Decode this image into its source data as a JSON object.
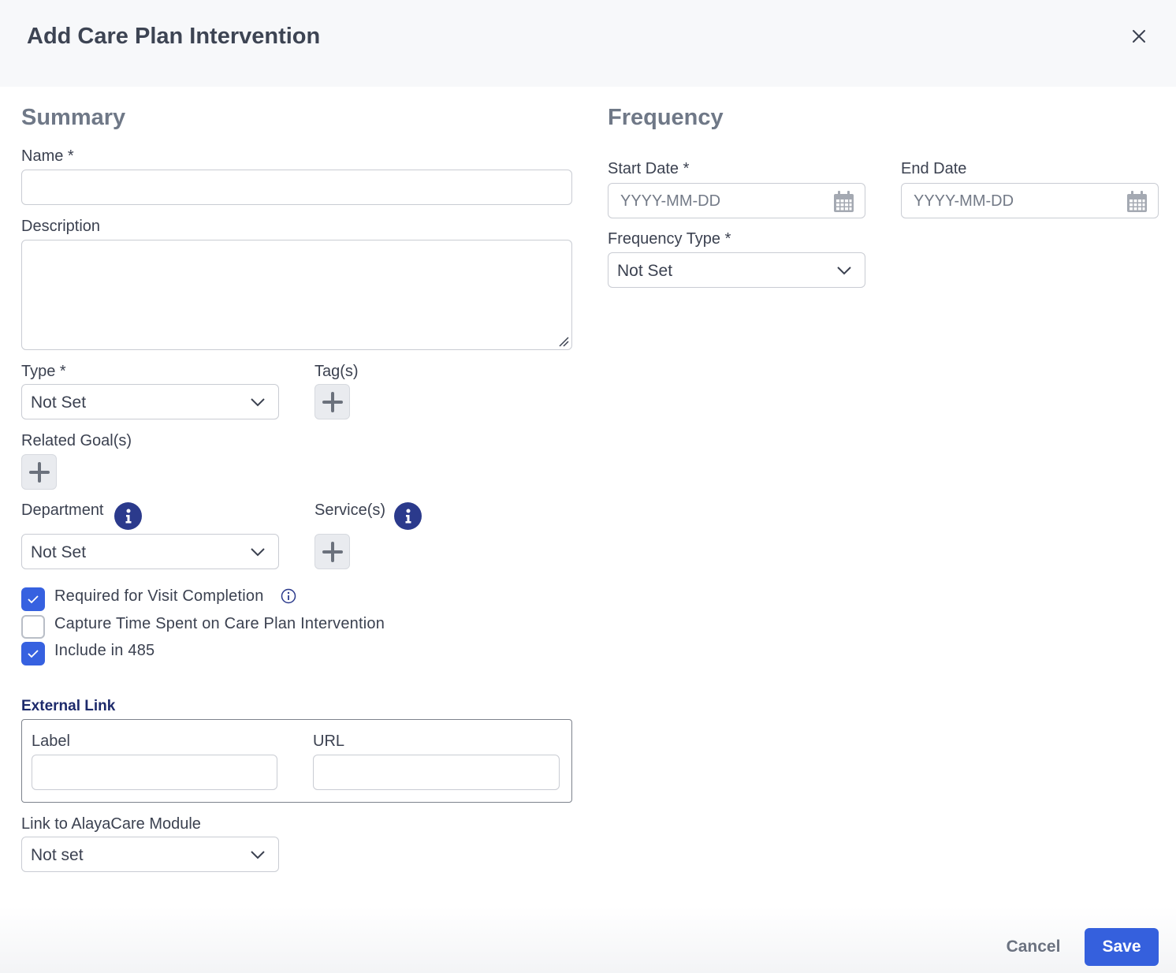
{
  "dialog": {
    "title": "Add Care Plan Intervention"
  },
  "summary": {
    "heading": "Summary",
    "name_label": "Name *",
    "name_value": "",
    "description_label": "Description",
    "description_value": "",
    "type_label": "Type *",
    "type_value": "Not Set",
    "tags_label": "Tag(s)",
    "related_goals_label": "Related Goal(s)",
    "department_label": "Department",
    "department_value": "Not Set",
    "services_label": "Service(s)",
    "checkboxes": [
      {
        "label": "Required for Visit Completion",
        "checked": true
      },
      {
        "label": "Capture Time Spent on Care Plan Intervention",
        "checked": false
      },
      {
        "label": "Include in 485",
        "checked": true
      }
    ],
    "external_link": {
      "heading": "External Link",
      "label_label": "Label",
      "label_value": "",
      "url_label": "URL",
      "url_value": ""
    },
    "module_label": "Link to AlayaCare Module",
    "module_value": "Not set"
  },
  "frequency": {
    "heading": "Frequency",
    "start_date_label": "Start Date *",
    "start_date_placeholder": "YYYY-MM-DD",
    "end_date_label": "End Date",
    "end_date_placeholder": "YYYY-MM-DD",
    "frequency_type_label": "Frequency Type *",
    "frequency_type_value": "Not Set"
  },
  "footer": {
    "cancel_label": "Cancel",
    "save_label": "Save"
  },
  "colors": {
    "primary": "#3560dd",
    "info_badge": "#2b3a8c",
    "heading_gray": "#6f7887",
    "header_bg": "#f7f8fa"
  }
}
